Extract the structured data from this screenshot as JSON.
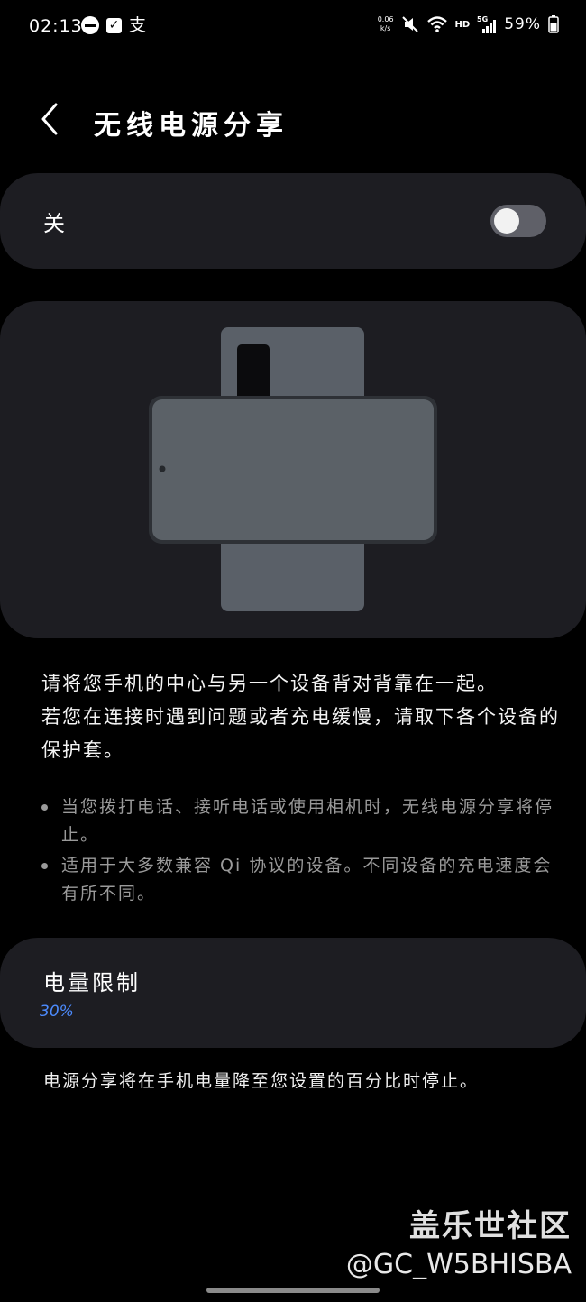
{
  "status_bar": {
    "time": "02:13",
    "net_speed_value": "0.06",
    "net_speed_unit": "k/s",
    "hd_label": "HD",
    "network_label": "5G",
    "battery_percent": "59%",
    "icons": [
      "dnd-icon",
      "check-icon",
      "alipay-icon",
      "mute-icon",
      "wifi-icon",
      "signal-icon",
      "battery-icon"
    ]
  },
  "header": {
    "title": "无线电源分享",
    "back_icon": "chevron-left-icon"
  },
  "toggle": {
    "label": "关",
    "state": "off"
  },
  "illustration": {
    "icon": "phone-back-to-back-illustration"
  },
  "description": {
    "line1": "请将您手机的中心与另一个设备背对背靠在一起。",
    "line2": "若您在连接时遇到问题或者充电缓慢，请取下各个设备的保护套。"
  },
  "notes": [
    "当您拨打电话、接听电话或使用相机时，无线电源分享将停止。",
    "适用于大多数兼容 Qi 协议的设备。不同设备的充电速度会有所不同。"
  ],
  "battery_limit": {
    "title": "电量限制",
    "value": "30%",
    "note": "电源分享将在手机电量降至您设置的百分比时停止。"
  },
  "watermark": {
    "title": "盖乐世社区",
    "user": "@GC_W5BHISBA"
  },
  "colors": {
    "background": "#000000",
    "card": "#1d1d22",
    "accent": "#4d8cff",
    "secondary_text": "#9a9a9a",
    "toggle_track": "#5f6068"
  }
}
